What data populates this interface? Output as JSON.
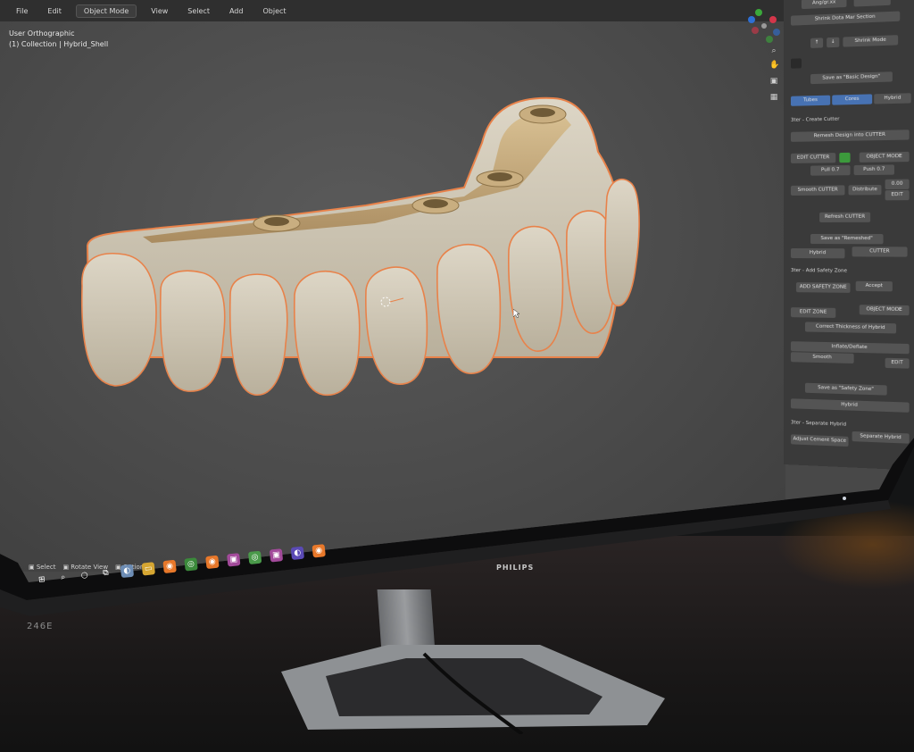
{
  "header": {
    "menu_file": "File",
    "menu_edit": "Edit",
    "mode": "Object Mode",
    "menu_view": "View",
    "menu_select": "Select",
    "menu_add": "Add",
    "menu_object": "Object"
  },
  "viewport": {
    "view_name": "User Orthographic",
    "collection": "(1) Collection | Hybrid_Shell"
  },
  "panel": {
    "top_a": "Ang/gr.xx",
    "top_b": "",
    "shrink": "Shrink Dota Mar Section",
    "shrink_mode": "Shrink Mode",
    "save_basic": "Save as \"Basic Design\"",
    "tab_tubes": "Tubes",
    "tab_cores": "Cores",
    "tab_hybrid": "Hybrid",
    "sec_cutter": "3ter - Create Cutter",
    "remesh": "Remesh Design into CUTTER",
    "edit_cutter": "EDIT CUTTER",
    "object_mode": "OBJECT MODE",
    "pull": "Pull 0.7",
    "push": "Push 0.7",
    "smooth_cutter": "Smooth CUTTER",
    "distribute": "Distribute",
    "val_a": "0.00",
    "edit": "EDIT",
    "refresh_cutter": "Refresh CUTTER",
    "save_remeshed": "Save as \"Remeshed\"",
    "hybrid": "Hybrid",
    "cutter": "CUTTER",
    "sec_safety": "3ter - Add Safety Zone",
    "add_safety": "ADD SAFETY ZONE",
    "accept": "Accept",
    "edit_zone": "EDIT ZONE",
    "object_mode_2": "OBJECT MODE",
    "correct_thickness": "Correct Thickness of Hybrid",
    "inflate_deflate": "Inflate/Deflate",
    "smooth": "Smooth",
    "edit_2": "EDIT",
    "save_safety": "Save as \"Safety Zone\"",
    "hybrid_2": "Hybrid",
    "sec_separate": "3ter - Separate Hybrid",
    "adjust_cement": "Adjust Cement Space",
    "separate_hybrid": "Separate Hybrid"
  },
  "statusbar": {
    "select": "Select",
    "rotate": "Rotate View",
    "options": "Options"
  },
  "monitor": {
    "brand": "PHILIPS",
    "model": "246E"
  },
  "colors": {
    "tooth": "#cfc6b4",
    "gum_gold": "#c8ad7f",
    "outline": "#e8824a",
    "viewport_bg": "#4b4b4b",
    "panel_bg": "#3a3a3a"
  }
}
